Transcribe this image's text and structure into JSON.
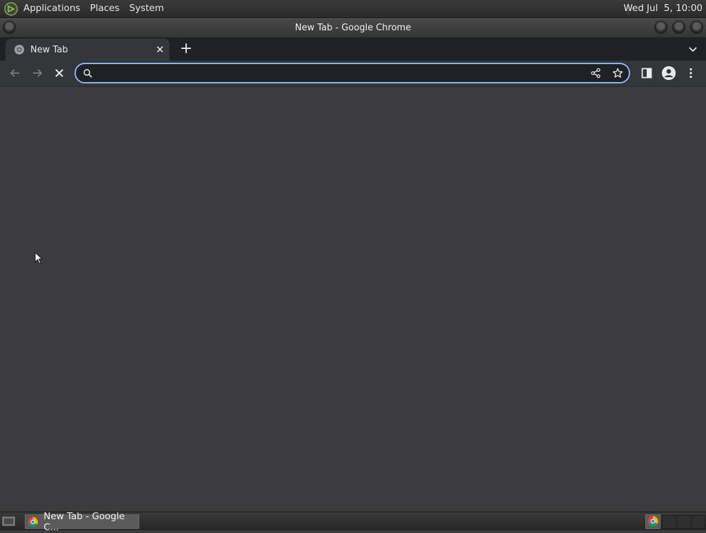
{
  "top_panel": {
    "menu": [
      "Applications",
      "Places",
      "System"
    ],
    "clock": "Wed Jul  5, 10:00"
  },
  "window": {
    "title": "New Tab - Google Chrome"
  },
  "tabs": [
    {
      "label": "New Tab",
      "active": true
    }
  ],
  "toolbar": {
    "omnibox_value": "",
    "omnibox_placeholder": ""
  },
  "taskbar": {
    "items": [
      {
        "label": "New Tab - Google C..."
      }
    ]
  },
  "colors": {
    "accent": "#8ab4f8",
    "content_bg": "#3c3c3f",
    "tabstrip_bg": "#202124",
    "toolbar_bg": "#35363a"
  },
  "icons": [
    "mate-logo-icon",
    "chrome-icon",
    "close-icon",
    "plus-icon",
    "chevron-down-icon",
    "back-icon",
    "forward-icon",
    "stop-icon",
    "search-icon",
    "share-icon",
    "star-icon",
    "side-panel-icon",
    "profile-icon",
    "kebab-menu-icon",
    "show-desktop-icon",
    "cursor-icon"
  ]
}
